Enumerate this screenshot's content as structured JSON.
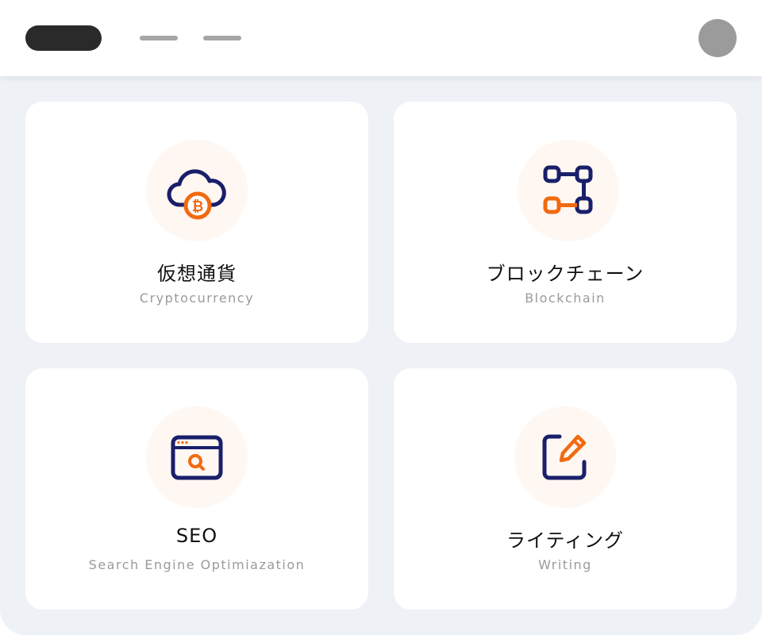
{
  "colors": {
    "navy": "#1a1f6b",
    "orange": "#f26a10",
    "icon_bg": "#fff7f2"
  },
  "cards": [
    {
      "title": "仮想通貨",
      "subtitle": "Cryptocurrency",
      "icon": "cloud-bitcoin-icon"
    },
    {
      "title": "ブロックチェーン",
      "subtitle": "Blockchain",
      "icon": "blockchain-nodes-icon"
    },
    {
      "title": "SEO",
      "subtitle": "Search Engine Optimiazation",
      "icon": "browser-search-icon"
    },
    {
      "title": "ライティング",
      "subtitle": "Writing",
      "icon": "edit-pencil-icon"
    }
  ]
}
